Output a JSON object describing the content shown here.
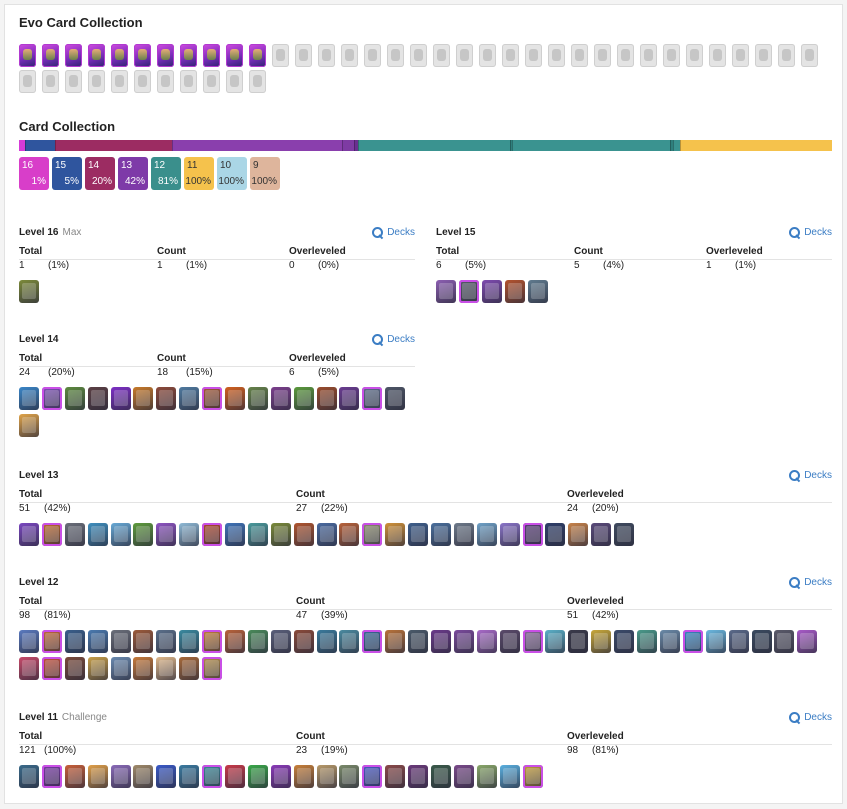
{
  "evo": {
    "title": "Evo Card Collection",
    "owned": 11,
    "total": 46
  },
  "collection": {
    "title": "Card Collection",
    "bar": [
      {
        "level": "16",
        "color": "#d63bd8",
        "weight": 1
      },
      {
        "level": "15",
        "color": "#2f559e",
        "weight": 5
      },
      {
        "level": "14",
        "color": "#9c2c62",
        "weight": 20
      },
      {
        "level": "13",
        "color": "#8a3fad",
        "weight": 29
      },
      {
        "level": "13",
        "color": "#7e3ba3",
        "weight": 2
      },
      {
        "level": "13",
        "color": "#6a2f90",
        "weight": 0.4
      },
      {
        "level": "12",
        "color": "#3a9390",
        "weight": 26
      },
      {
        "level": "12",
        "color": "#2f7f7d",
        "weight": 0.3
      },
      {
        "level": "12",
        "color": "#3a9390",
        "weight": 27
      },
      {
        "level": "12",
        "color": "#2f7f7d",
        "weight": 0.3
      },
      {
        "level": "12",
        "color": "#3a9390",
        "weight": 1
      },
      {
        "level": "11",
        "color": "#f5c24c",
        "weight": 26
      }
    ],
    "legend": [
      {
        "level": "16",
        "pct": "1%",
        "color": "#d83ec9",
        "light": false
      },
      {
        "level": "15",
        "pct": "5%",
        "color": "#2f559e",
        "light": false
      },
      {
        "level": "14",
        "pct": "20%",
        "color": "#9c2c62",
        "light": false
      },
      {
        "level": "13",
        "pct": "42%",
        "color": "#7e3aa8",
        "light": false
      },
      {
        "level": "12",
        "pct": "81%",
        "color": "#3a8f8c",
        "light": false
      },
      {
        "level": "11",
        "pct": "100%",
        "color": "#f5c24c",
        "light": true
      },
      {
        "level": "10",
        "pct": "100%",
        "color": "#aad6e6",
        "light": true
      },
      {
        "level": "9",
        "pct": "100%",
        "color": "#deb59c",
        "light": true
      }
    ]
  },
  "labels": {
    "total": "Total",
    "count": "Count",
    "overleveled": "Overleveled",
    "decks": "Decks"
  },
  "levels": [
    {
      "id": "16",
      "title": "Level 16",
      "sub": "Max",
      "total": "1",
      "total_pct": "(1%)",
      "count": "1",
      "count_pct": "(1%)",
      "over": "0",
      "over_pct": "(0%)",
      "cards": [
        "#7c8a3a"
      ]
    },
    {
      "id": "15",
      "title": "Level 15",
      "sub": "",
      "total": "6",
      "total_pct": "(5%)",
      "count": "5",
      "count_pct": "(4%)",
      "over": "1",
      "over_pct": "(1%)",
      "cards": [
        "#8c5fb2",
        "#575a6a",
        "#7e4bb0",
        "#b4532e",
        "#607b8f"
      ]
    },
    {
      "id": "14",
      "title": "Level 14",
      "sub": "",
      "total": "24",
      "total_pct": "(20%)",
      "count": "18",
      "count_pct": "(15%)",
      "over": "6",
      "over_pct": "(5%)",
      "cards": [
        "#3a86c8",
        "#7f52b8",
        "#5d8a3f",
        "#5b3f44",
        "#7d2fc6",
        "#c87a2a",
        "#8d4a3a",
        "#4f7aa0",
        "#a65a38",
        "#d2601f",
        "#66834a",
        "#7b3f8d",
        "#5b9a3c",
        "#9a4c2c",
        "#6a3c91",
        "#5f6f8c",
        "#4d5566",
        "#e0a44a"
      ]
    },
    {
      "id": "13",
      "title": "Level 13",
      "sub": "",
      "total": "51",
      "total_pct": "(42%)",
      "count": "27",
      "count_pct": "(22%)",
      "over": "24",
      "over_pct": "(20%)",
      "cards": [
        "#7a47c0",
        "#c36b2e",
        "#6b6f7a",
        "#3f8fbf",
        "#67a9d6",
        "#5e9b3c",
        "#8e54c2",
        "#8fbad6",
        "#b3482e",
        "#3f73b8",
        "#4a9a9c",
        "#7a8a3a",
        "#b0552f",
        "#4a6aa0",
        "#b8623a",
        "#8f8f70",
        "#d0923a",
        "#3f5f8c",
        "#4a6f9c",
        "#6e7a8a",
        "#6fa2c8",
        "#8a74c8",
        "#5b3e7a",
        "#2f3f6a",
        "#c8834a",
        "#5a4a7a",
        "#3f4a5f"
      ]
    },
    {
      "id": "12",
      "title": "Level 12",
      "sub": "",
      "total": "98",
      "total_pct": "(81%)",
      "count": "47",
      "count_pct": "(39%)",
      "over": "51",
      "over_pct": "(42%)",
      "cards": [
        "#5a7ac0",
        "#c86a3a",
        "#3a5f8c",
        "#4a7ab0",
        "#6b6f7a",
        "#9c5a3a",
        "#5a6f8a",
        "#3a8aa0",
        "#c8803a",
        "#b8623a",
        "#4a8a5a",
        "#5a5f7a",
        "#8a4a3a",
        "#3a7a9c",
        "#4a8aa0",
        "#3a6a9c",
        "#b8723a",
        "#4a5a6a",
        "#6a3a8a",
        "#7a4a9c",
        "#a86ac8",
        "#5a4a6a",
        "#8a6a9c",
        "#5ab0c8",
        "#3a3a4a",
        "#c8a83a",
        "#3a4a6a",
        "#4a9a8a",
        "#6a8aa8",
        "#3a8ac8",
        "#6ab8e0",
        "#5a6a8a",
        "#3a4a5f",
        "#5a5a6a",
        "#a85ac8",
        "#c84a6a",
        "#c8503a",
        "#7a4a3a",
        "#c8a04a",
        "#6a8ab0",
        "#c87a3a",
        "#e0b88a",
        "#a86a3a",
        "#b8904a"
      ]
    },
    {
      "id": "11",
      "title": "Level 11",
      "sub": "Challenge",
      "total": "121",
      "total_pct": "(100%)",
      "count": "23",
      "count_pct": "(19%)",
      "over": "98",
      "over_pct": "(81%)",
      "cards": [
        "#3a6a8a",
        "#7a3aa8",
        "#c8603a",
        "#e0a04a",
        "#8a6ab8",
        "#a08a6a",
        "#3a5ac8",
        "#3a7aa0",
        "#3a8a9a",
        "#c83a4a",
        "#3aa84a",
        "#8a3ab8",
        "#c8803a",
        "#b89a6a",
        "#7a8a6a",
        "#4a5ac8",
        "#8a4a4a",
        "#6a3a7a",
        "#3a5a4a",
        "#7a4a8a",
        "#8aa86a",
        "#5ab0e0",
        "#c8a03a"
      ]
    }
  ]
}
